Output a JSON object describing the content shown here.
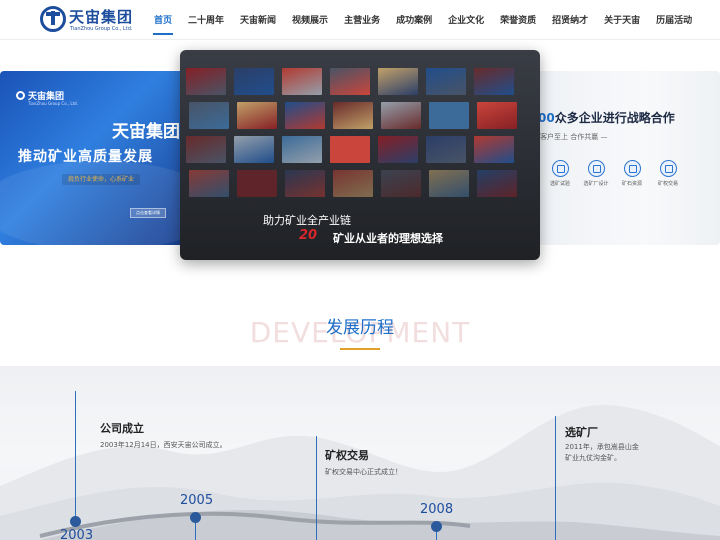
{
  "header": {
    "logo_cn": "天宙集团",
    "logo_en": "TianZhou Group Co., Ltd.",
    "nav": [
      "首页",
      "二十周年",
      "天宙新闻",
      "视频展示",
      "主营业务",
      "成功案例",
      "企业文化",
      "荣誉资质",
      "招贤纳才",
      "关于天宙",
      "历届活动"
    ],
    "active_index": 0,
    "accent": "#1d6fc9"
  },
  "carousel": {
    "left_slide": {
      "logo": "天宙集团",
      "logo_en": "TianZhou Group Co., Ltd.",
      "title": "天宙集团",
      "slogan": "推动矿业高质量发展",
      "subtitle": "肩负行业使命，心系矿业",
      "button": "点击查看详情"
    },
    "center_slide": {
      "line1": "助力矿业全产业链",
      "number": "20",
      "line2": "矿业从业者的理想选择"
    },
    "right_slide": {
      "title_num": "00",
      "title": "众多企业进行战略合作",
      "subtitle": "客户至上  合作共赢 —",
      "icons": [
        {
          "icon": "flask-icon",
          "label": "选矿试验"
        },
        {
          "icon": "design-icon",
          "label": "选矿厂设计"
        },
        {
          "icon": "ore-icon",
          "label": "矿石资源"
        },
        {
          "icon": "rights-icon",
          "label": "矿权交易"
        }
      ]
    }
  },
  "development": {
    "bg_text": "DEVELOPMENT",
    "title": "发展历程",
    "events": [
      {
        "title": "公司成立",
        "desc": "2003年12月14日，西安天宙公司成立。"
      },
      {
        "title": "矿权交易",
        "desc": "矿权交易中心正式成立！"
      },
      {
        "title": "选矿厂",
        "desc": "2011年，承包嵩县山金矿业九仗沟金矿。"
      }
    ],
    "years": [
      "2003",
      "2005",
      "2008"
    ]
  }
}
